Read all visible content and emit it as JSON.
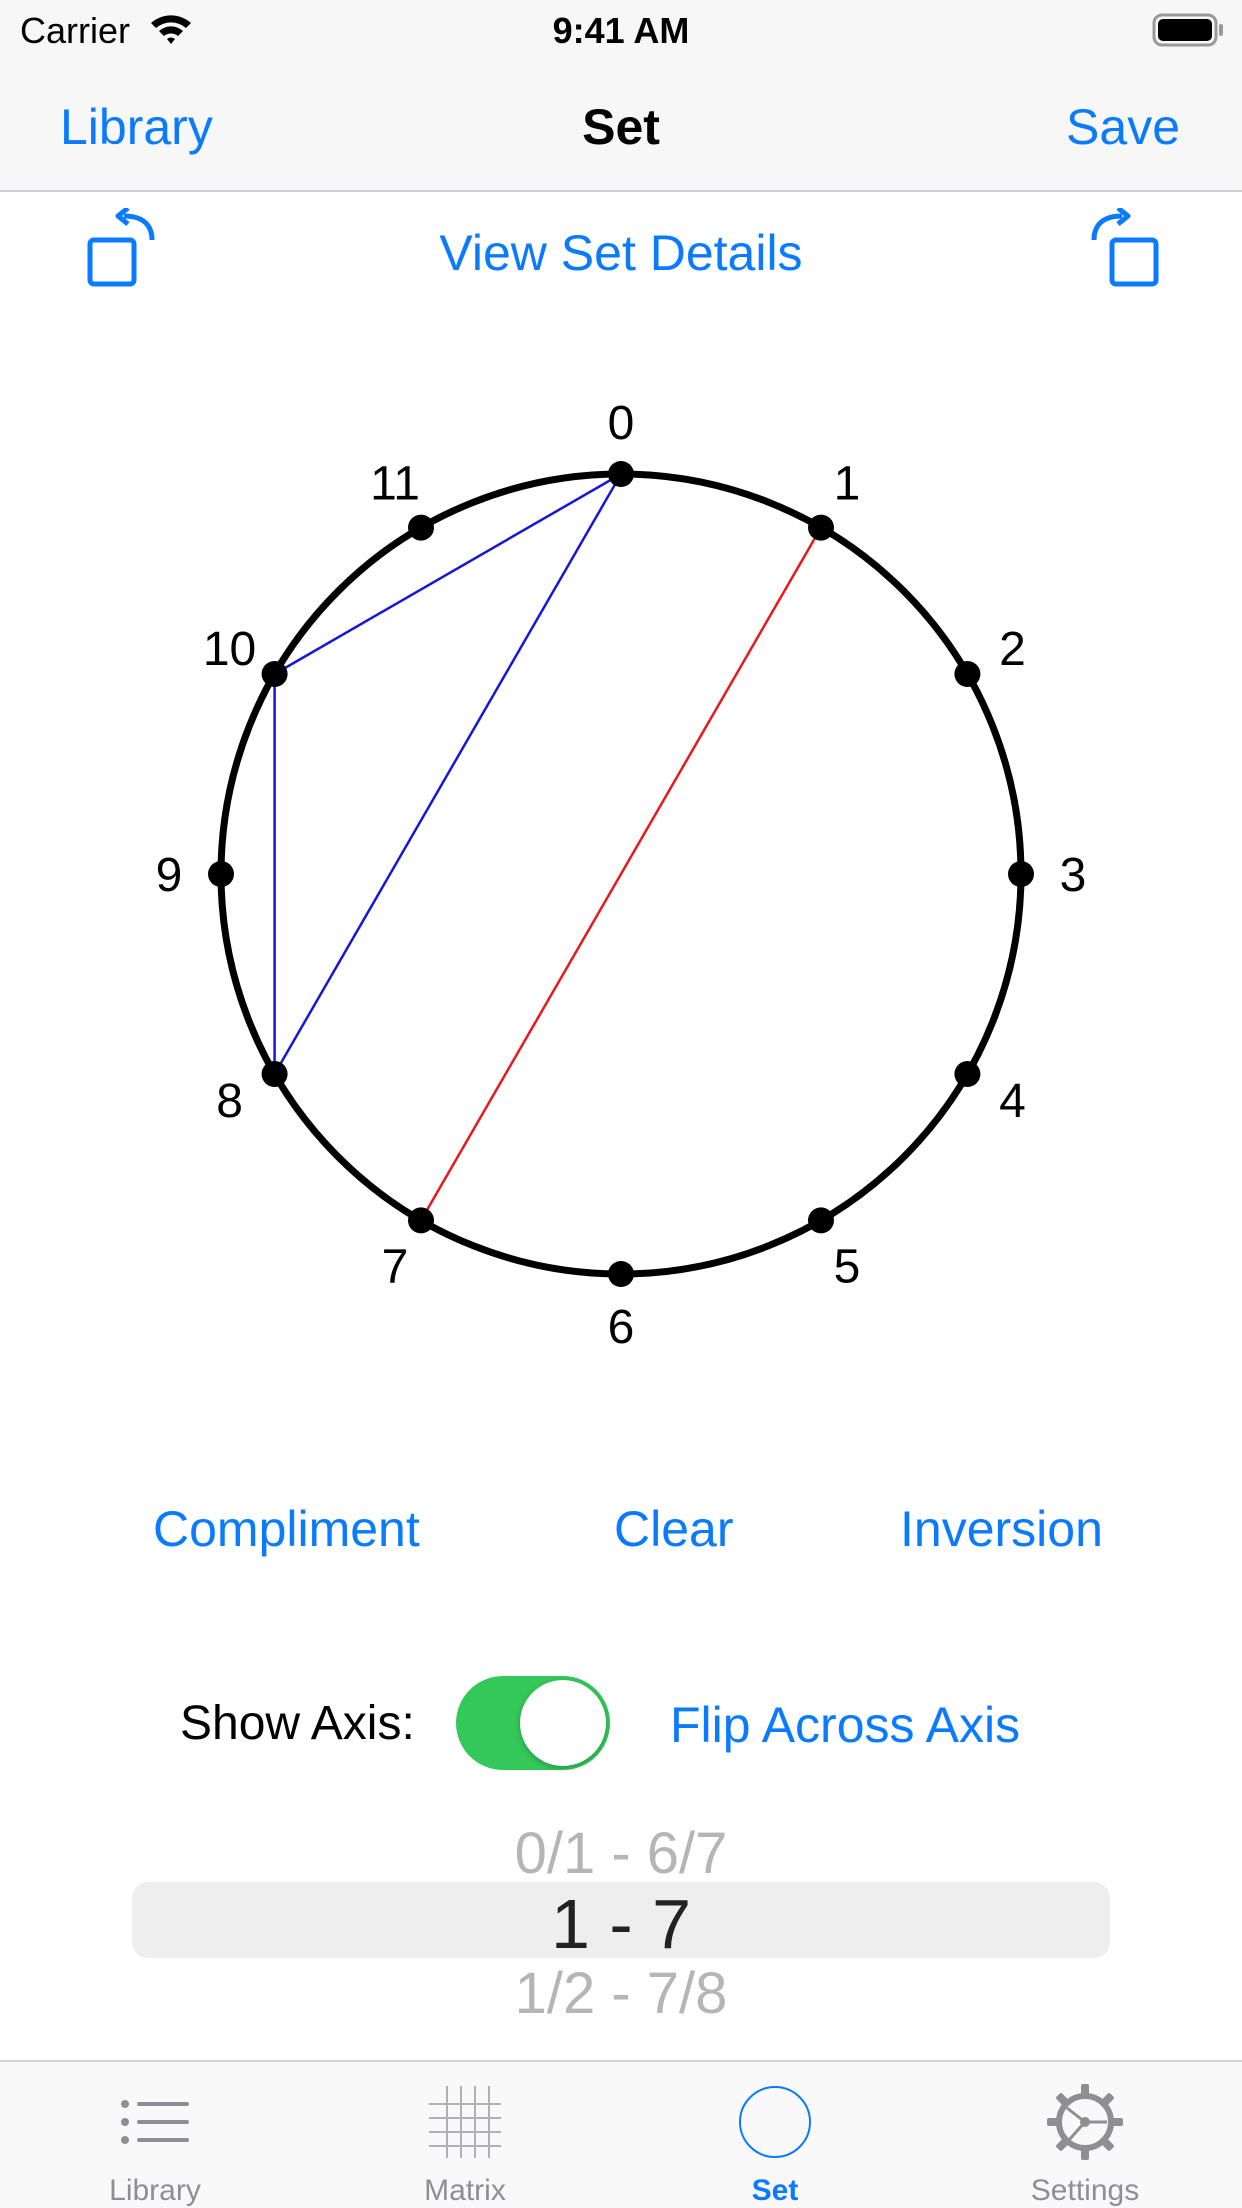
{
  "status_bar": {
    "carrier": "Carrier",
    "time": "9:41 AM"
  },
  "nav_bar": {
    "back_label": "Library",
    "title": "Set",
    "save_label": "Save"
  },
  "toolbar": {
    "view_details_label": "View Set Details",
    "rotate_left_icon": "rotate-left-icon",
    "rotate_right_icon": "rotate-right-icon"
  },
  "clock": {
    "pitch_labels": [
      "0",
      "1",
      "2",
      "3",
      "4",
      "5",
      "6",
      "7",
      "8",
      "9",
      "10",
      "11"
    ],
    "selected_set": [
      0,
      8,
      10
    ],
    "set_line_color": "#1616d6",
    "axis": [
      1,
      7
    ],
    "axis_line_color": "#e8181e",
    "circle_color": "#000000"
  },
  "actions": {
    "compliment_label": "Compliment",
    "clear_label": "Clear",
    "inversion_label": "Inversion"
  },
  "axis_controls": {
    "show_axis_label": "Show Axis:",
    "show_axis_on": true,
    "flip_label": "Flip Across Axis"
  },
  "axis_picker": {
    "above": "0/1 - 6/7",
    "selected": "1 - 7",
    "below": "1/2 - 7/8"
  },
  "tab_bar": {
    "tabs": [
      {
        "label": "Library",
        "icon": "list-icon",
        "active": false
      },
      {
        "label": "Matrix",
        "icon": "grid-icon",
        "active": false
      },
      {
        "label": "Set",
        "icon": "circle-icon",
        "active": true
      },
      {
        "label": "Settings",
        "icon": "gear-icon",
        "active": false
      }
    ]
  },
  "colors": {
    "accent": "#0a7aff",
    "toggle_on": "#34c759"
  }
}
